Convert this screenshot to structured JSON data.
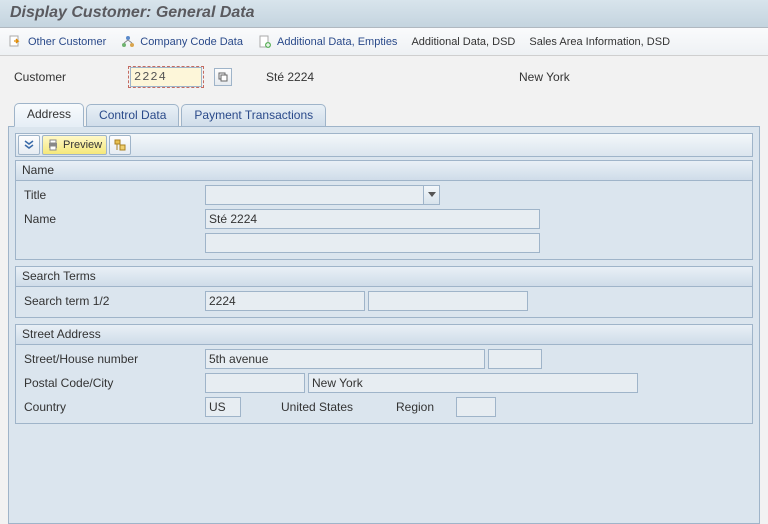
{
  "title": "Display Customer: General Data",
  "appbar": {
    "other_customer": "Other Customer",
    "company_code_data": "Company Code Data",
    "additional_data_empties": "Additional Data, Empties",
    "additional_data_dsd": "Additional Data, DSD",
    "sales_area_info_dsd": "Sales Area Information, DSD"
  },
  "header": {
    "customer_label": "Customer",
    "customer_value": "2224",
    "customer_name": "Sté 2224",
    "customer_city": "New York"
  },
  "tabs": {
    "address": "Address",
    "control_data": "Control Data",
    "payment_transactions": "Payment Transactions"
  },
  "toolbar": {
    "preview": "Preview"
  },
  "groups": {
    "name": {
      "heading": "Name",
      "title_label": "Title",
      "title_value": "",
      "name_label": "Name",
      "name_value": "Sté 2224",
      "name_value2": ""
    },
    "search": {
      "heading": "Search Terms",
      "term_label": "Search term 1/2",
      "term_value": "2224",
      "term_value2": ""
    },
    "street": {
      "heading": "Street Address",
      "street_label": "Street/House number",
      "street_value": "5th avenue",
      "house_value": "",
      "postal_label": "Postal Code/City",
      "postal_value": "",
      "city_value": "New York",
      "country_label": "Country",
      "country_code": "US",
      "country_name": "United States",
      "region_label": "Region",
      "region_value": ""
    }
  }
}
